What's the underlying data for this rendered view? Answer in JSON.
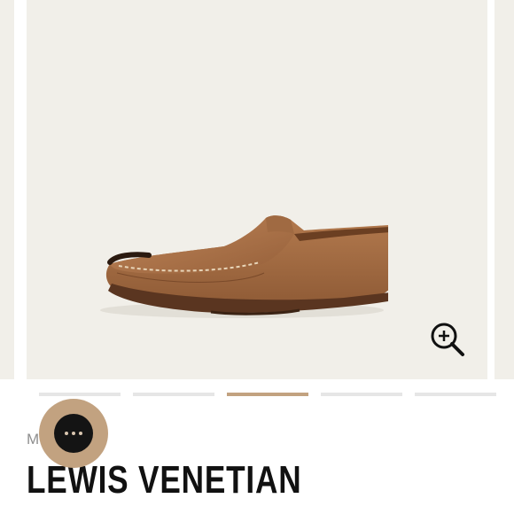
{
  "product": {
    "brand_partial": "M",
    "name": "LEWIS VENETIAN"
  },
  "gallery": {
    "slide_count": 5,
    "active_slide": 3,
    "zoom_icon": "zoom-in-icon"
  },
  "chat": {
    "icon": "chat-bubble-icon"
  },
  "colors": {
    "image_background": "#f1efe9",
    "accent": "#c2a280",
    "indicator_inactive": "#e6e6e6",
    "title_text": "#111111",
    "chat_inner": "#141414"
  }
}
